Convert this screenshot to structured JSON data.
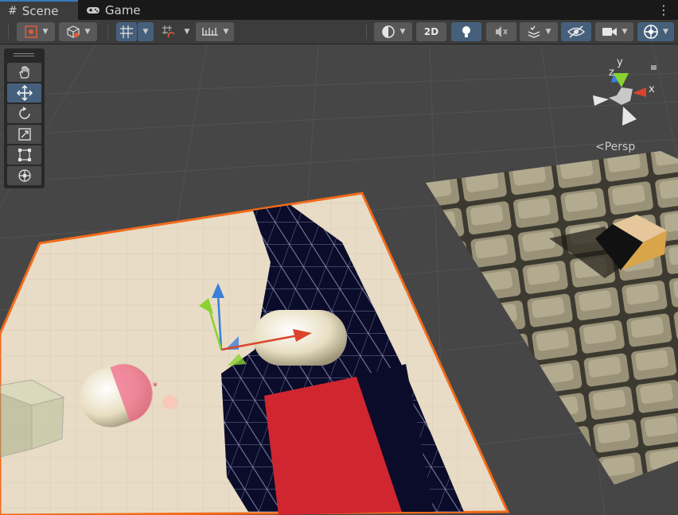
{
  "tabs": [
    {
      "label": "Scene",
      "icon": "grid-hash-icon",
      "active": true
    },
    {
      "label": "Game",
      "icon": "gamepad-icon",
      "active": false
    }
  ],
  "toolbar": {
    "mode_2d_label": "2D",
    "active_color": "#46607c",
    "items": [
      "draw-mode",
      "shading-mode",
      "grid-snap",
      "increment-snap",
      "snap-settings",
      "orientation",
      "2d-toggle",
      "lighting-toggle",
      "audio-toggle",
      "effects-menu",
      "hidden-objects-toggle",
      "camera-settings",
      "gizmos-toggle"
    ]
  },
  "tools": [
    "hand-tool",
    "move-tool",
    "rotate-tool",
    "scale-tool",
    "rect-tool",
    "transform-tool"
  ],
  "active_tool": "move-tool",
  "orientation_gizmo": {
    "axis_y": "y",
    "axis_x": "x",
    "axis_z": "z",
    "projection_label": "Persp",
    "colors": {
      "x": "#d9452c",
      "y": "#8ad132",
      "z": "#3a7fd7"
    }
  },
  "scene": {
    "selection_outline_color": "#f26a1b",
    "plane_color": "#e8dcc6",
    "red_box_color": "#d0262f",
    "shadow_color": "#0b0c2a"
  }
}
